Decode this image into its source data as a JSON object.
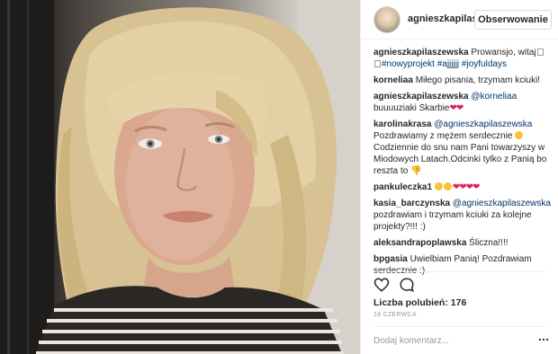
{
  "post": {
    "username": "agnieszkapilaszewska",
    "header_username": "agnieszkapilas",
    "follow_label": "Obserwowanie"
  },
  "comments": [
    {
      "user": "agnieszkapilaszewska",
      "text": "Prowansjo, witaj",
      "tags": "#nowyprojekt #ajjjjjj #joyfuldays"
    },
    {
      "user": "korneliaa",
      "text": "Miłego pisania, trzymam kciuki!"
    },
    {
      "user": "agnieszkapilaszewska",
      "mention": "@korneliaa",
      "text": "buuuuziaki Skarbie"
    },
    {
      "user": "karolinakrasa",
      "mention": "@agnieszkapilaszewska",
      "text": "Pozdrawiamy z mężem serdecznie",
      "text2": "Codziennie do snu nam Pani towarzyszy w Miodowych Latach.Odcinki tylko z Panią bo reszta to"
    },
    {
      "user": "pankuleczka1"
    },
    {
      "user": "kasia_barczynska",
      "mention": "@agnieszkapilaszewska",
      "text": "pozdrawiam i trzymam kciuki za kolejne projekty?!!! :)"
    },
    {
      "user": "aleksandrapoplawska",
      "text": "Śliczna!!!!"
    },
    {
      "user": "bpgasia",
      "text": "Uwielbiam Panią! Pozdrawiam serdecznie :)"
    }
  ],
  "likes": {
    "label": "Liczba polubień:",
    "count": "176"
  },
  "date": "18 CZERWCA",
  "add_comment_placeholder": "Dodaj komentarz...",
  "colors": {
    "link": "#003569",
    "heart": "#e0245e",
    "border": "#efefef",
    "muted": "#999999"
  },
  "icons": {
    "like": "heart-outline-icon",
    "comment": "speech-bubble-icon",
    "more": "three-dots-icon"
  }
}
